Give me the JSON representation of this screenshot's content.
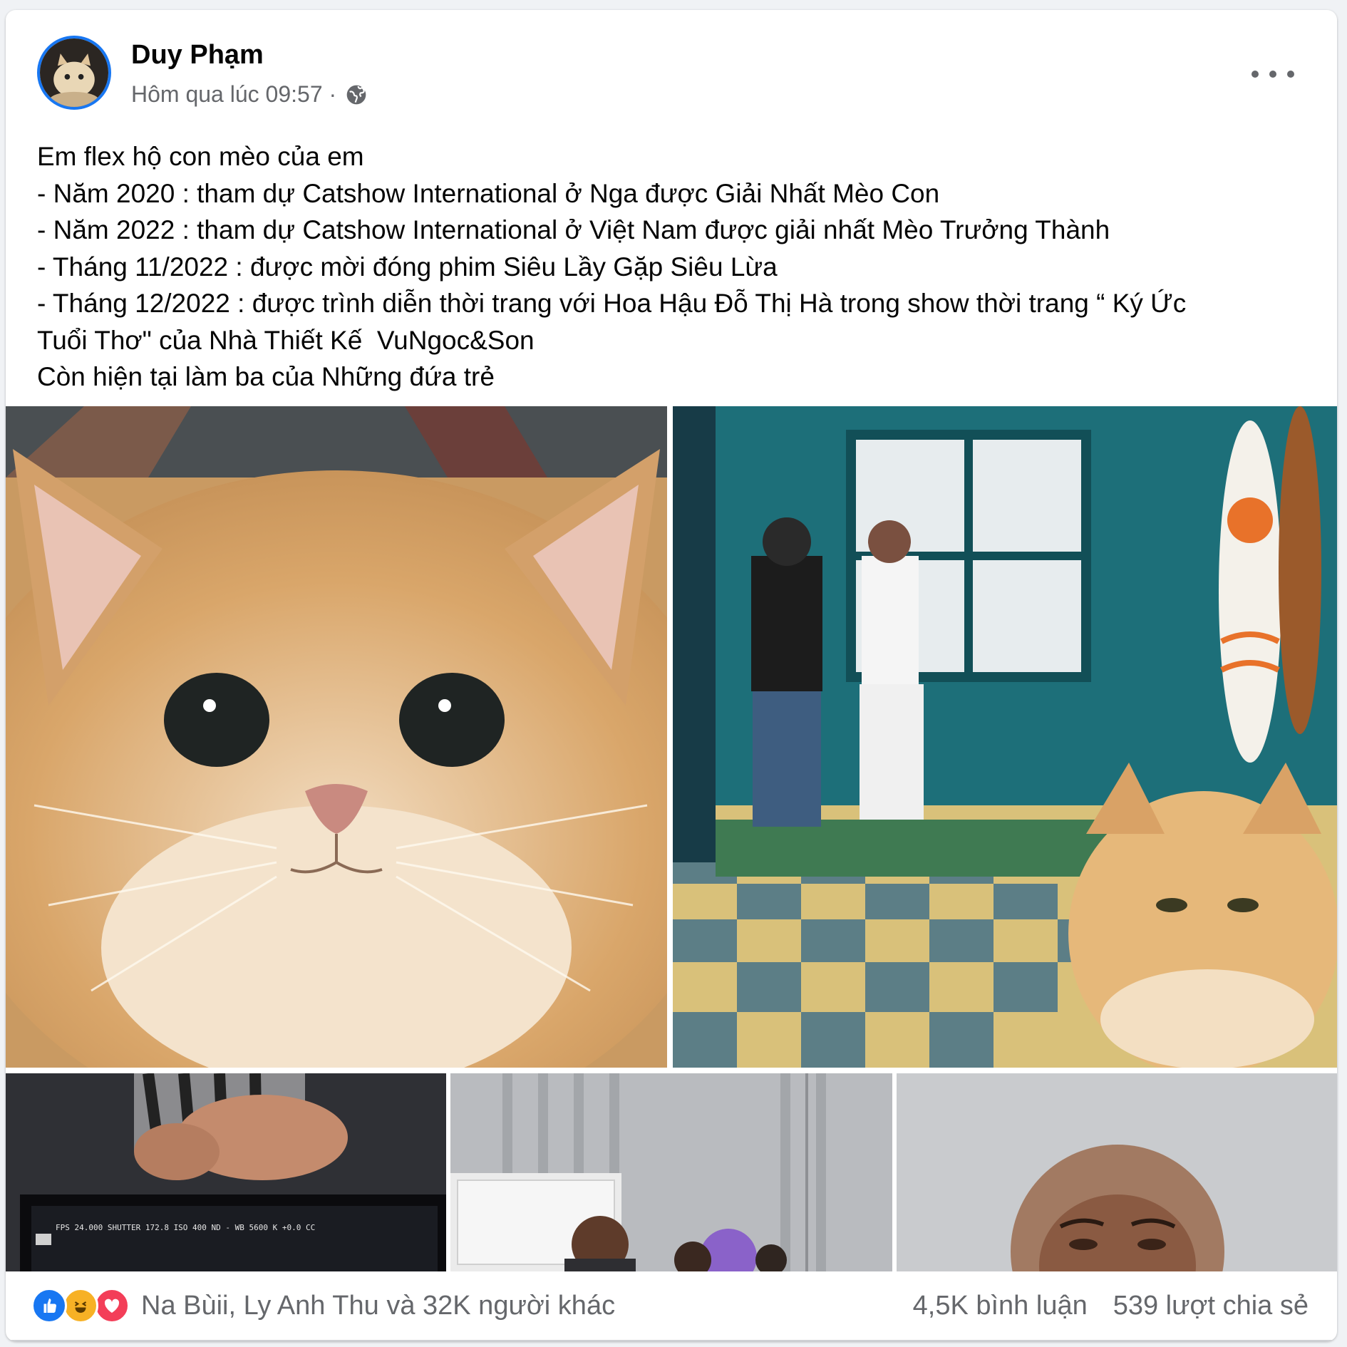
{
  "post": {
    "author": "Duy Phạm",
    "timestamp": "Hôm qua lúc 09:57 ·",
    "privacy_icon": "globe-icon",
    "more_icon": "more-horizontal-icon",
    "text_lines": [
      "Em flex hộ con mèo của em",
      "- Năm 2020 : tham dự Catshow International ở Nga được Giải Nhất Mèo Con",
      "- Năm 2022 : tham dự Catshow International ở Việt Nam được giải nhất Mèo Trưởng Thành",
      "- Tháng 11/2022 : được mời đóng phim Siêu Lầy Gặp Siêu Lừa",
      "- Tháng 12/2022 : được trình diễn thời trang với Hoa Hậu Đỗ Thị Hà trong show thời trang “ Ký Ức",
      "Tuổi Thơ\" của Nhà Thiết Kế  VuNgoc&Son",
      "Còn hiện tại làm ba của Những đứa trẻ"
    ],
    "photos": [
      {
        "name": "photo-cat-closeup"
      },
      {
        "name": "photo-golf-set-with-cat"
      },
      {
        "name": "photo-camera-monitor"
      },
      {
        "name": "photo-studio-people"
      },
      {
        "name": "photo-woman-headscarf"
      }
    ],
    "monitor_readout": "FPS 24.000   SHUTTER 172.8      ISO 400  ND -      WB 5600 K  +0.0 CC"
  },
  "footer": {
    "reaction_icons": [
      "like-icon",
      "haha-icon",
      "love-icon"
    ],
    "reaction_summary": "Na Bùii, Ly Anh Thu và 32K người khác",
    "comments": "4,5K bình luận",
    "shares": "539 lượt chia sẻ"
  },
  "colors": {
    "accent": "#1877f2",
    "secondary_text": "#65676b",
    "like": "#1877f2",
    "haha": "#f7b125",
    "love": "#f33e58"
  }
}
